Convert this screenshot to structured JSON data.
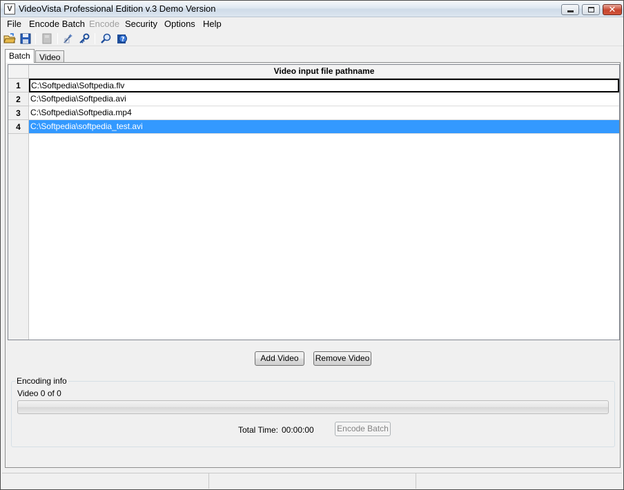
{
  "window": {
    "title": "VideoVista Professional Edition v.3 Demo Version",
    "app_icon_glyph": "V"
  },
  "menu": {
    "items": [
      {
        "label": "File",
        "enabled": true
      },
      {
        "label": "Encode Batch",
        "enabled": true
      },
      {
        "label": "Encode",
        "enabled": false
      },
      {
        "label": "Security",
        "enabled": true
      },
      {
        "label": "Options",
        "enabled": true
      },
      {
        "label": "Help",
        "enabled": true
      }
    ]
  },
  "toolbar": {
    "icons": [
      "open-folder-icon",
      "save-icon",
      "encode-icon",
      "wand-icon",
      "key-icon",
      "search-icon",
      "help-icon"
    ]
  },
  "tabs": [
    {
      "label": "Batch",
      "active": true
    },
    {
      "label": "Video",
      "active": false
    }
  ],
  "table": {
    "column_header": "Video input file pathname",
    "rows": [
      {
        "num": "1",
        "path": "C:\\Softpedia\\Softpedia.flv",
        "state": "focused"
      },
      {
        "num": "2",
        "path": "C:\\Softpedia\\Softpedia.avi",
        "state": "normal"
      },
      {
        "num": "3",
        "path": "C:\\Softpedia\\Softpedia.mp4",
        "state": "normal"
      },
      {
        "num": "4",
        "path": "C:\\Softpedia\\softpedia_test.avi",
        "state": "selected"
      }
    ]
  },
  "buttons": {
    "add_video": "Add Video",
    "remove_video": "Remove Video",
    "encode_batch": "Encode Batch"
  },
  "encoding_info": {
    "group_label": "Encoding info",
    "video_count": "Video 0 of 0",
    "progress_fraction": 0,
    "total_time_label": "Total Time:",
    "total_time_value": "00:00:00"
  },
  "colors": {
    "selection": "#3399ff",
    "close_button": "#c7452e"
  }
}
